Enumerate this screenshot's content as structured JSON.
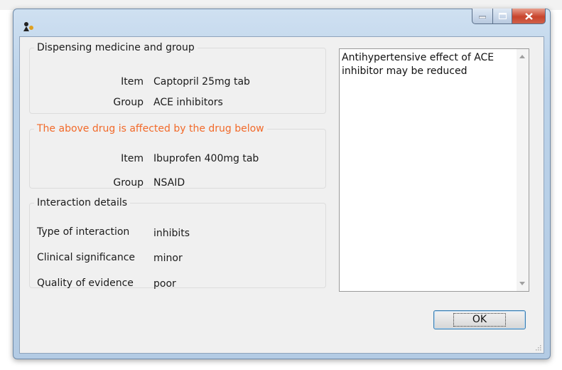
{
  "dialog": {
    "window_buttons": {
      "minimize": "minimize-icon",
      "maximize": "maximize-icon",
      "close": "close-icon"
    },
    "dispensing": {
      "legend": "Dispensing medicine and group",
      "item_label": "Item",
      "item_value": "Captopril 25mg tab",
      "group_label": "Group",
      "group_value": "ACE inhibitors"
    },
    "affected_by": {
      "legend": "The above drug is affected by the drug below",
      "legend_color": "#f26a2a",
      "item_label": "Item",
      "item_value": "Ibuprofen 400mg tab",
      "group_label": "Group",
      "group_value": "NSAID"
    },
    "interaction": {
      "legend": "Interaction details",
      "type_label": "Type of interaction",
      "type_value": "inhibits",
      "significance_label": "Clinical significance",
      "significance_value": "minor",
      "quality_label": "Quality of evidence",
      "quality_value": "poor"
    },
    "notes_text": "Antihypertensive effect of ACE inhibitor may be reduced",
    "ok_label": "OK"
  }
}
